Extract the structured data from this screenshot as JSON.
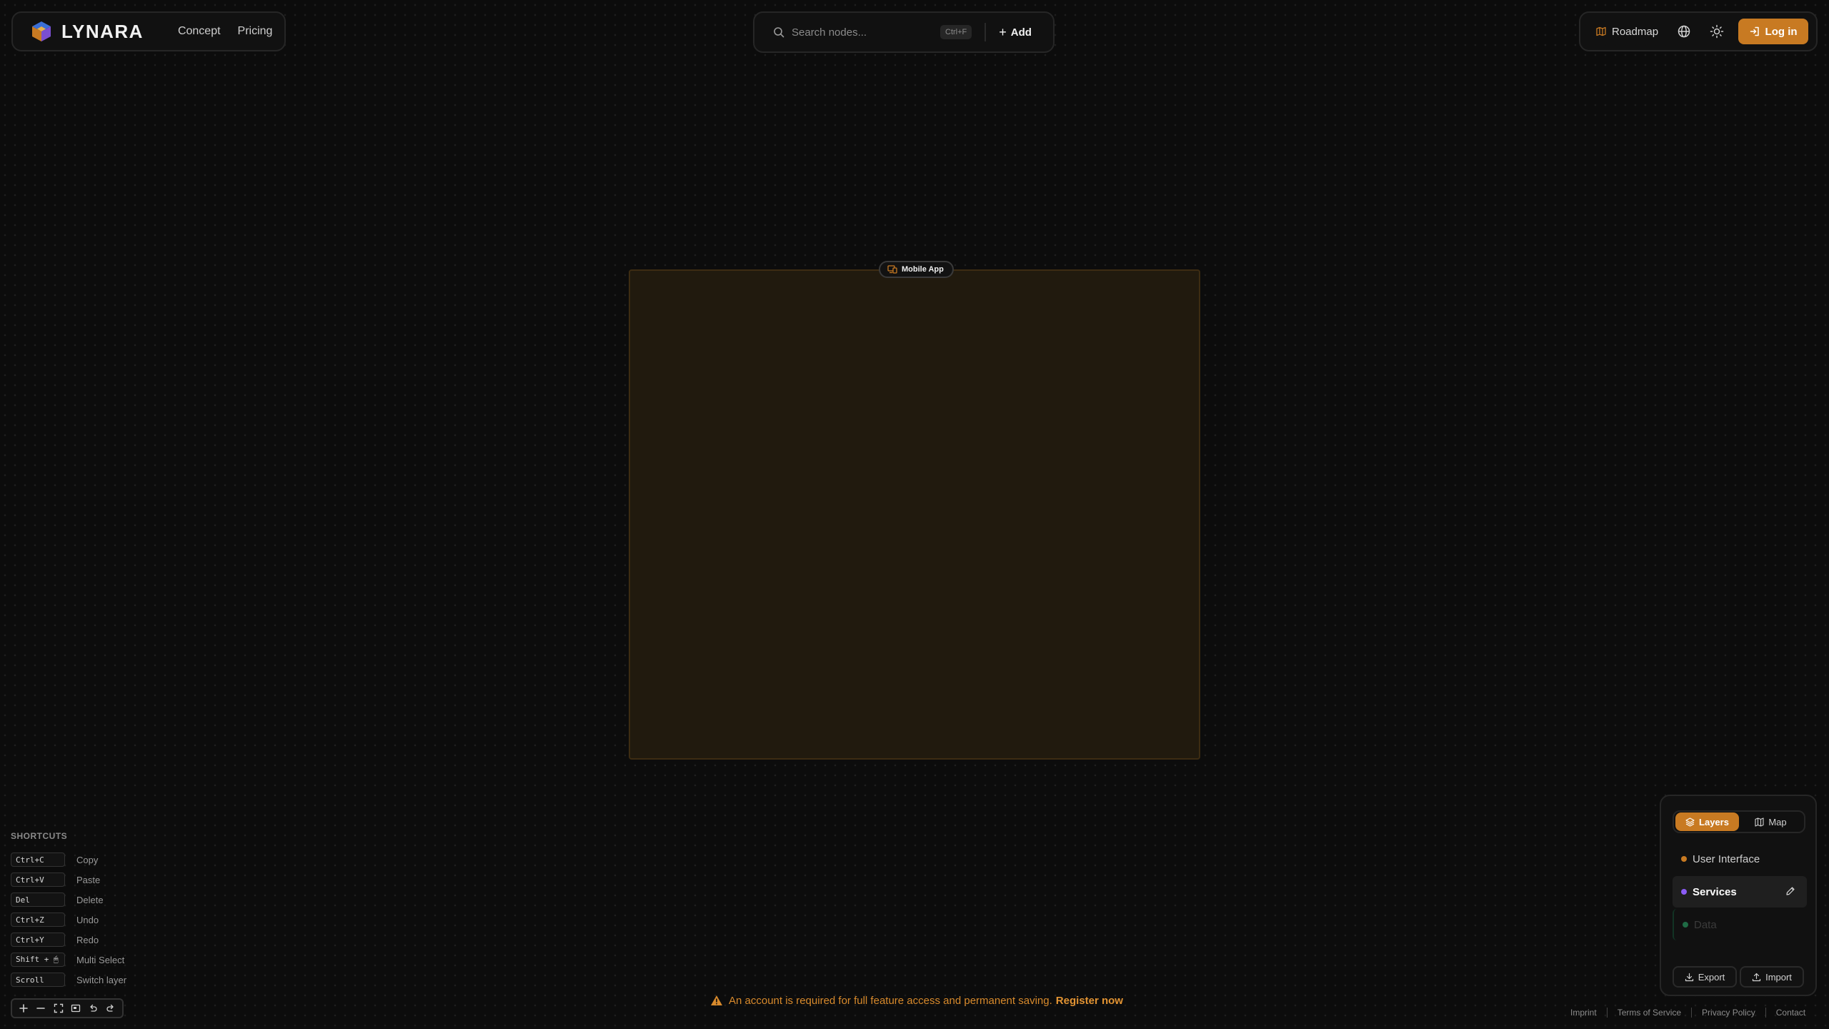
{
  "brand": {
    "name": "LYNARA"
  },
  "nav": {
    "items": [
      {
        "label": "Concept"
      },
      {
        "label": "Pricing"
      }
    ]
  },
  "search": {
    "placeholder": "Search nodes...",
    "shortcut": "Ctrl+F",
    "add_label": "Add"
  },
  "header_right": {
    "roadmap_label": "Roadmap",
    "login_label": "Log in",
    "icons": [
      "globe-icon",
      "sun-icon"
    ]
  },
  "canvas": {
    "group_node": {
      "label": "Mobile App",
      "icon": "devices-icon"
    }
  },
  "shortcuts": {
    "title": "SHORTCUTS",
    "items": [
      {
        "key": "Ctrl+C",
        "desc": "Copy"
      },
      {
        "key": "Ctrl+V",
        "desc": "Paste"
      },
      {
        "key": "Del",
        "desc": "Delete"
      },
      {
        "key": "Ctrl+Z",
        "desc": "Undo"
      },
      {
        "key": "Ctrl+Y",
        "desc": "Redo"
      },
      {
        "key": "Shift + 🖱",
        "desc": "Multi Select"
      },
      {
        "key": "Scroll",
        "desc": "Switch layer"
      }
    ]
  },
  "zoom_toolbar": {
    "buttons": [
      "zoom-in-icon",
      "zoom-out-icon",
      "fit-view-icon",
      "minimap-icon",
      "undo-icon",
      "redo-icon"
    ]
  },
  "warning": {
    "text": "An account is required for full feature access and permanent saving.",
    "link": "Register now"
  },
  "layers_panel": {
    "tabs": [
      {
        "label": "Layers",
        "active": true
      },
      {
        "label": "Map",
        "active": false
      }
    ],
    "layers": [
      {
        "label": "User Interface",
        "color": "#c87a22",
        "state": "normal"
      },
      {
        "label": "Services",
        "color": "#8b5cf6",
        "state": "selected"
      },
      {
        "label": "Data",
        "color": "#1f6b45",
        "state": "muted"
      }
    ],
    "export_label": "Export",
    "import_label": "Import"
  },
  "footer": {
    "links": [
      {
        "label": "Imprint"
      },
      {
        "label": "Terms of Service"
      },
      {
        "label": "Privacy Policy"
      },
      {
        "label": "Contact"
      }
    ]
  },
  "colors": {
    "accent": "#c87a22",
    "background": "#0c0c0c",
    "node_fill": "#211a0e"
  }
}
